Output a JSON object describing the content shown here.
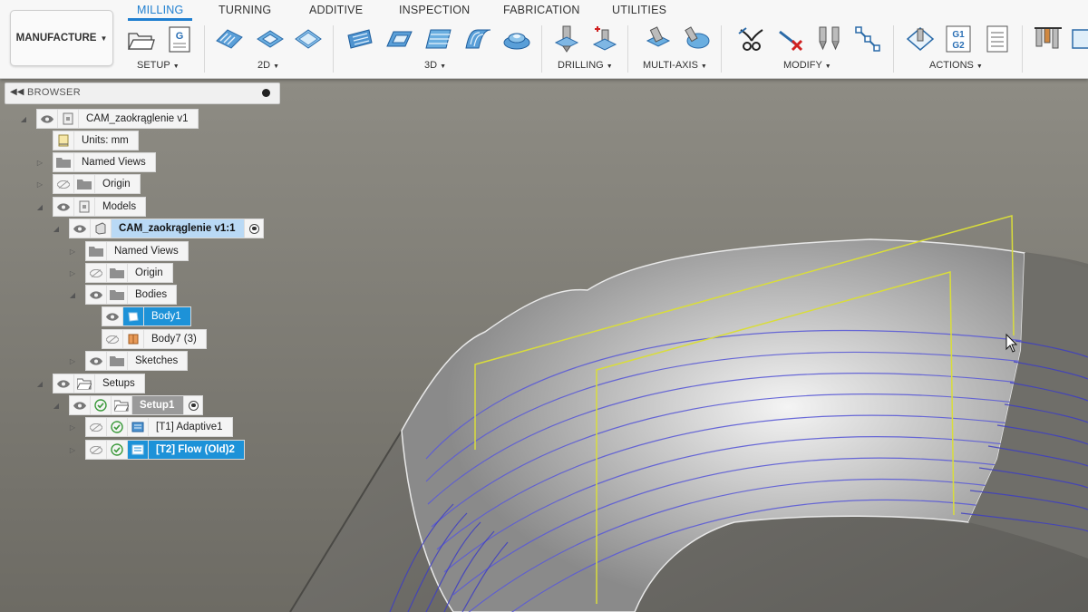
{
  "toolbar": {
    "workspace": "MANUFACTURE",
    "tabs": [
      "MILLING",
      "TURNING",
      "ADDITIVE",
      "INSPECTION",
      "FABRICATION",
      "UTILITIES"
    ],
    "active_tab": "MILLING",
    "groups": {
      "setup": "SETUP",
      "two_d": "2D",
      "three_d": "3D",
      "drilling": "DRILLING",
      "multi_axis": "MULTI-AXIS",
      "modify": "MODIFY",
      "actions": "ACTIONS"
    },
    "accent_color": "#1f7fd0"
  },
  "browser": {
    "title": "BROWSER",
    "root": "CAM_zaokrąglenie v1",
    "units": "Units: mm",
    "named_views": "Named Views",
    "origin": "Origin",
    "models": "Models",
    "component": "CAM_zaokrąglenie v1:1",
    "comp_named_views": "Named Views",
    "comp_origin": "Origin",
    "bodies": "Bodies",
    "body1": "Body1",
    "body7": "Body7 (3)",
    "sketches": "Sketches",
    "setups": "Setups",
    "setup1": "Setup1",
    "op1": "[T1] Adaptive1",
    "op2": "[T2] Flow (Old)2",
    "selection_color": "#1d92d8"
  }
}
